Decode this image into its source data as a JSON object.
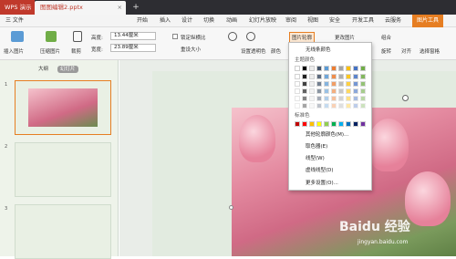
{
  "app": {
    "name": "WPS 演示",
    "doc_tab": "图图编辑2.pptx",
    "add_tab": "+"
  },
  "menu": {
    "file": "三 文件",
    "items": [
      "开始",
      "插入",
      "设计",
      "切换",
      "动画",
      "幻灯片放映",
      "审阅",
      "视图",
      "安全",
      "开发工具",
      "云服务"
    ],
    "active": "图片工具"
  },
  "ribbon": {
    "insert_pic": "插入图片",
    "compress": "压缩图片",
    "crop": "裁剪",
    "height_label": "高度:",
    "height_value": "13.44厘米",
    "width_label": "宽度:",
    "width_value": "23.89厘米",
    "lock_ratio": "锁定纵横比",
    "reset_size": "重设大小",
    "transparent": "设置透明色",
    "color": "颜色",
    "outline": "图片轮廓",
    "change_pic": "更改图片",
    "combine": "组合",
    "rotate": "旋转",
    "align": "对齐",
    "select_pane": "选择窗格"
  },
  "panel": {
    "outline_tab": "大纲",
    "slides_tab": "幻灯片",
    "slide_numbers": [
      "1",
      "2",
      "3"
    ]
  },
  "dropdown": {
    "no_outline": "无线条颜色",
    "theme_colors": "主题颜色",
    "standard_colors": "标准色",
    "more_colors": "其他轮廓颜色(M)...",
    "eyedropper": "取色器(E)",
    "line_style": "线型(W)",
    "dash_style": "虚线线型(D)",
    "more_settings": "更多设置(O)..."
  },
  "colors": {
    "theme_row1": [
      "#ffffff",
      "#000000",
      "#ececec",
      "#44546a",
      "#5b9bd5",
      "#ed7d31",
      "#a5a5a5",
      "#ffc000",
      "#4472c4",
      "#70ad47"
    ],
    "standard": [
      "#c00000",
      "#ff0000",
      "#ffc000",
      "#ffff00",
      "#92d050",
      "#00b050",
      "#00b0f0",
      "#0070c0",
      "#002060",
      "#7030a0"
    ],
    "accent": "#e67e22"
  },
  "watermark": {
    "brand": "Baidu 经验",
    "url": "jingyan.baidu.com"
  }
}
